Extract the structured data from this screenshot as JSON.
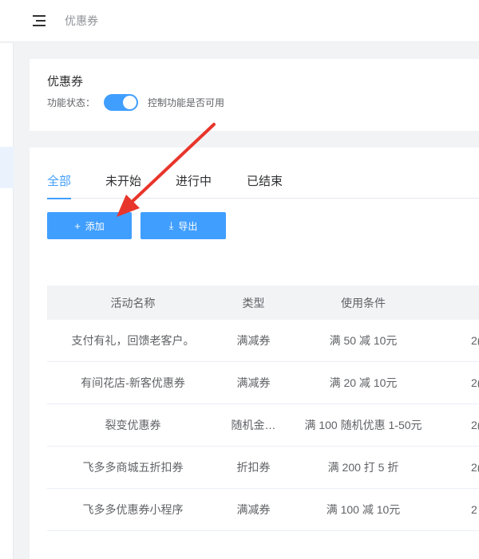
{
  "header": {
    "title": "优惠券"
  },
  "status_card": {
    "title": "优惠券",
    "status_label": "功能状态：",
    "toggle_on": true,
    "toggle_hint": "控制功能是否可用"
  },
  "tabs": [
    {
      "label": "全部",
      "active": true
    },
    {
      "label": "未开始",
      "active": false
    },
    {
      "label": "进行中",
      "active": false
    },
    {
      "label": "已结束",
      "active": false
    }
  ],
  "toolbar": {
    "add_icon": "+",
    "add_label": "添加",
    "export_icon": "⤓",
    "export_label": "导出"
  },
  "table": {
    "columns": [
      "活动名称",
      "类型",
      "使用条件",
      ""
    ],
    "rows": [
      [
        "支付有礼，回馈老客户。",
        "满减券",
        "满 50 减 10元",
        "2("
      ],
      [
        "有间花店-新客优惠券",
        "满减券",
        "满 20 减 10元",
        "2("
      ],
      [
        "裂变优惠券",
        "随机金…",
        "满 100 随机优惠 1-50元",
        "2("
      ],
      [
        "飞多多商城五折扣券",
        "折扣券",
        "满 200 打 5 折",
        "2("
      ],
      [
        "飞多多优惠券小程序",
        "满减券",
        "满 100 减 10元",
        "2"
      ]
    ]
  },
  "colors": {
    "primary": "#409eff",
    "annotation_arrow": "#e8352b"
  }
}
